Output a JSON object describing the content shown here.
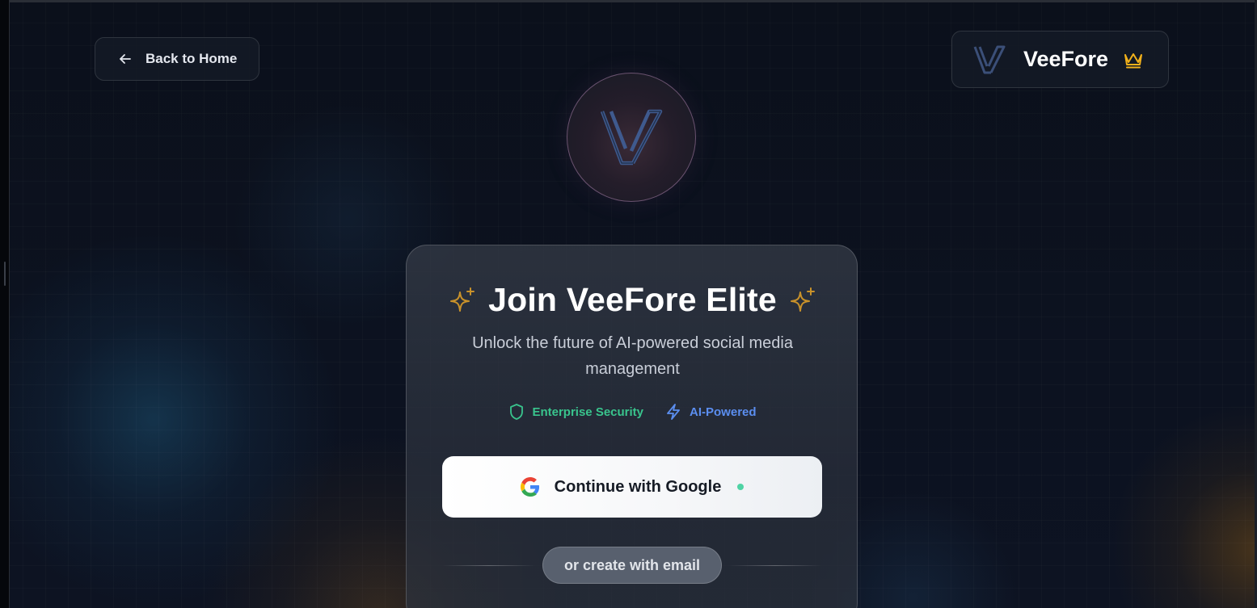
{
  "nav": {
    "back_label": "Back to Home"
  },
  "brand": {
    "name": "VeeFore",
    "crown_color": "#f1b11b"
  },
  "card": {
    "title": "Join VeeFore Elite",
    "subtitle": "Unlock the future of AI-powered social media management",
    "badges": [
      {
        "label": "Enterprise Security",
        "icon": "shield-icon",
        "color": "#39c48d"
      },
      {
        "label": "AI-Powered",
        "icon": "lightning-icon",
        "color": "#5b8ef0"
      }
    ],
    "google_button_label": "Continue with Google",
    "divider_label": "or create with email"
  },
  "colors": {
    "accent_gold": "#c9922a",
    "background": "#0a0f1a"
  }
}
